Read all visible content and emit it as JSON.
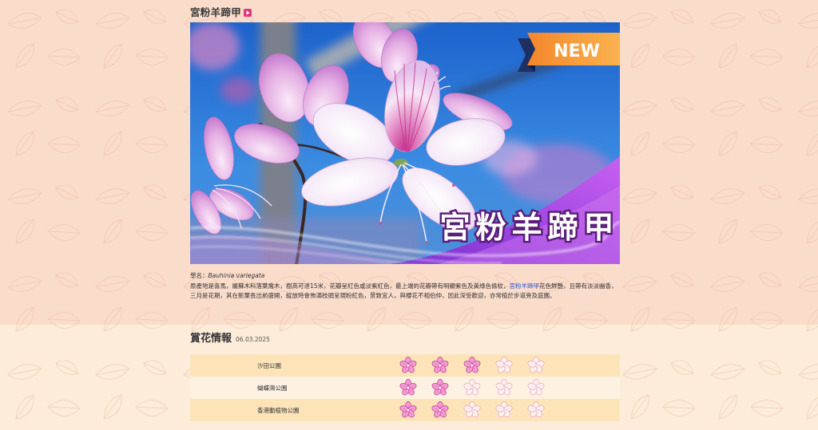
{
  "header": {
    "title": "宮粉羊蹄甲",
    "play_icon": "play-icon"
  },
  "photo": {
    "badge": "NEW",
    "overlay_title": "宮粉羊蹄甲"
  },
  "info": {
    "scientific_label": "學名：",
    "scientific_name": "Bauhinia variegata",
    "description_before_link": "原產地是喜馬，屬蘇木科落葉喬木，樹高可達15米，花瓣呈紅色或淡紫紅色，最上端的花瓣帶有明顯紫色及黃綠色條紋，",
    "link_text": "宮粉羊蹄甲",
    "description_after_link": "花色鮮艷，且帶有淡淡幽香，三月是花期，其在新葉長出前盛開，綻放時會佈滿枝頭呈現粉紅色，景致宜人，與櫻花不相伯仲，因此深受歡迎，亦常植於步道旁及庭園。"
  },
  "flower_report": {
    "title": "賞花情報",
    "date": "06.03.2025",
    "rating_max": 5,
    "rating_icon": "bauhinia-flower-icon",
    "rows": [
      {
        "location": "沙田公園",
        "rating": 3
      },
      {
        "location": "蝴蝶灣公園",
        "rating": 2
      },
      {
        "location": "香港動植物公園",
        "rating": 2
      }
    ]
  },
  "colors": {
    "top_background": "#fadccb",
    "bottom_background": "#fcecd9",
    "row_highlight": "#fde4b8",
    "row_plain": "#fdf2e2",
    "link": "#3158d6",
    "play_icon": "#e2357a",
    "rating_filled": "#f4a3d6",
    "rating_filled_outline": "#c8409a",
    "rating_empty": "#fff8ef",
    "rating_empty_outline": "#e6a6c9",
    "badge_orange": "#f7a03b",
    "overlay_purple": "#9b3be0"
  }
}
